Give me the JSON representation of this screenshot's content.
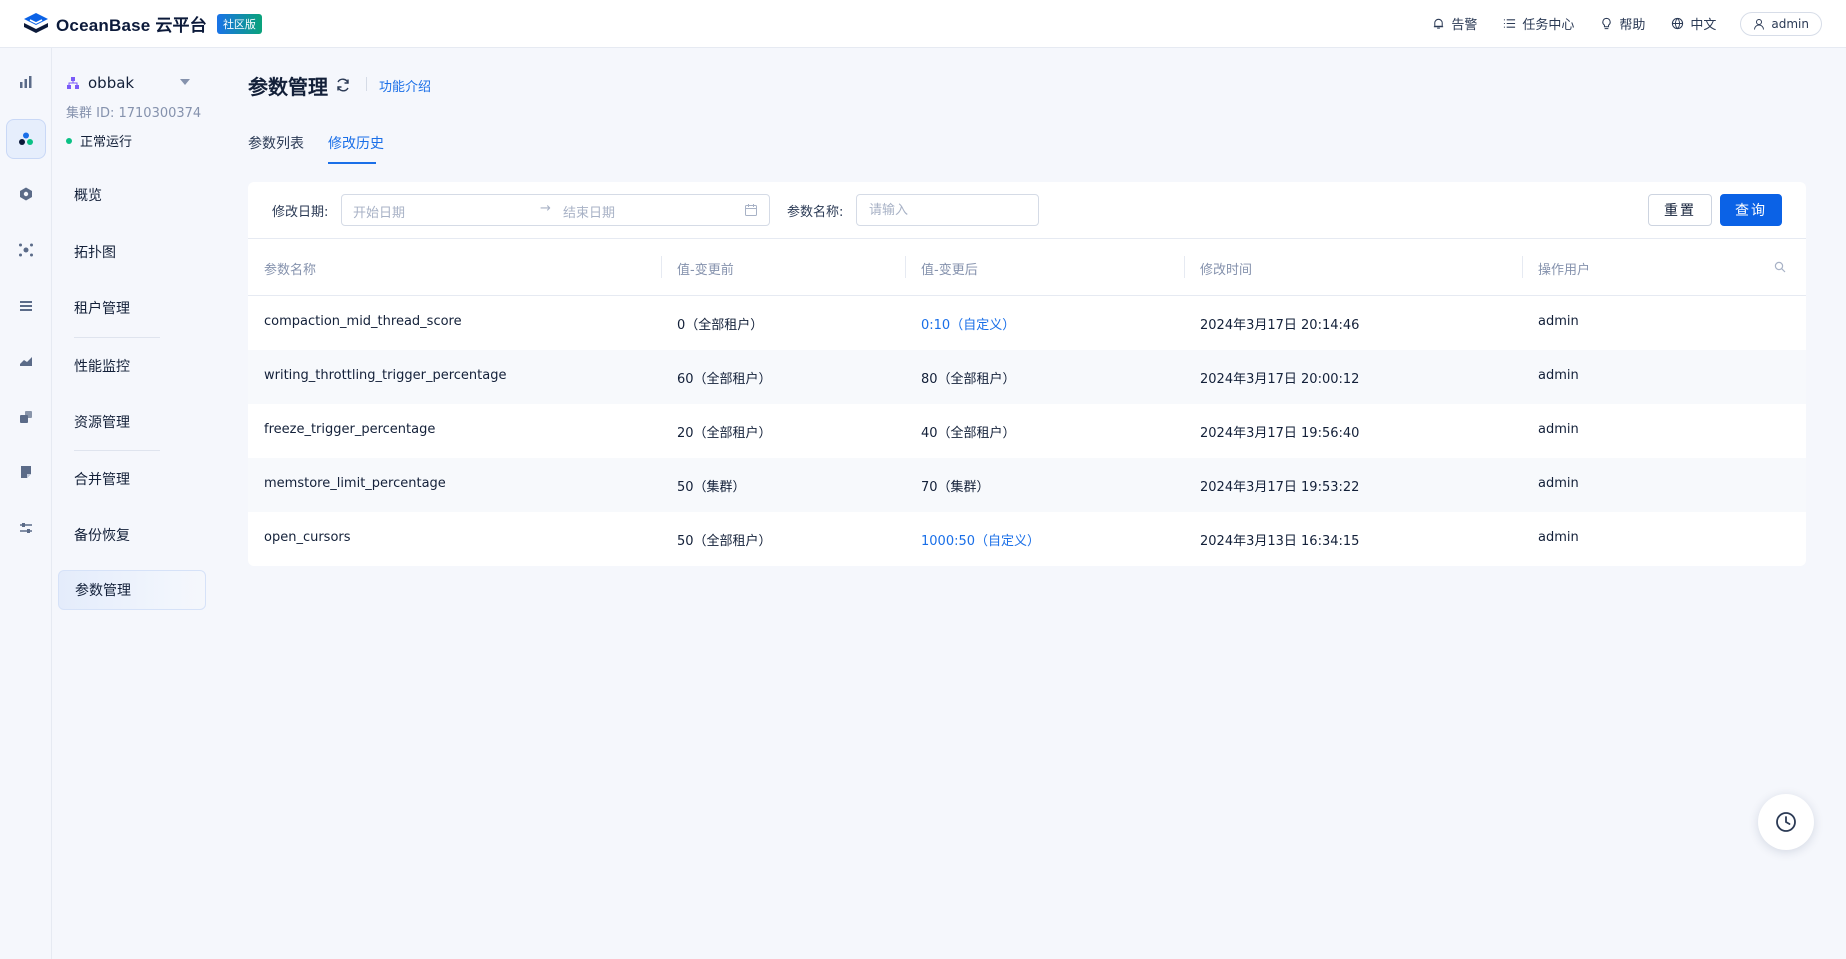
{
  "header": {
    "brand_name": "OceanBase 云平台",
    "brand_badge": "社区版",
    "alert_label": "告警",
    "task_center_label": "任务中心",
    "help_label": "帮助",
    "language_label": "中文",
    "user_label": "admin"
  },
  "cluster": {
    "name": "obbak",
    "id_text": "集群 ID: 1710300374",
    "status_text": "正常运行",
    "status_color": "#0ac185"
  },
  "subnav": {
    "items": [
      "概览",
      "拓扑图",
      "租户管理",
      "性能监控",
      "资源管理",
      "合并管理",
      "备份恢复",
      "参数管理"
    ],
    "active_index": 7
  },
  "page": {
    "title": "参数管理",
    "intro_link": "功能介绍",
    "tabs": [
      "参数列表",
      "修改历史"
    ],
    "active_tab": 1
  },
  "filters": {
    "date_label": "修改日期:",
    "start_placeholder": "开始日期",
    "arrow": "→",
    "end_placeholder": "结束日期",
    "name_label": "参数名称:",
    "name_placeholder": "请输入",
    "reset_label": "重置",
    "query_label": "查询"
  },
  "table": {
    "columns": [
      "参数名称",
      "值-变更前",
      "值-变更后",
      "修改时间",
      "操作用户"
    ],
    "rows": [
      {
        "name": "compaction_mid_thread_score",
        "before": "0（全部租户）",
        "after": "0:10（自定义）",
        "after_link": true,
        "time": "2024年3月17日 20:14:46",
        "user": "admin"
      },
      {
        "name": "writing_throttling_trigger_percentage",
        "before": "60（全部租户）",
        "after": "80（全部租户）",
        "after_link": false,
        "time": "2024年3月17日 20:00:12",
        "user": "admin"
      },
      {
        "name": "freeze_trigger_percentage",
        "before": "20（全部租户）",
        "after": "40（全部租户）",
        "after_link": false,
        "time": "2024年3月17日 19:56:40",
        "user": "admin"
      },
      {
        "name": "memstore_limit_percentage",
        "before": "50（集群）",
        "after": "70（集群）",
        "after_link": false,
        "time": "2024年3月17日 19:53:22",
        "user": "admin"
      },
      {
        "name": "open_cursors",
        "before": "50（全部租户）",
        "after": "1000:50（自定义）",
        "after_link": true,
        "time": "2024年3月13日 16:34:15",
        "user": "admin"
      }
    ]
  },
  "colors": {
    "accent": "#1a6fe8",
    "primary_button": "#0b62e6",
    "text": "#132039",
    "muted": "#8592ad"
  },
  "icons": {
    "rail": [
      "bar-chart-icon",
      "cluster-icon",
      "tenant-icon",
      "topology-icon",
      "list-icon",
      "monitor-icon",
      "resource-icon",
      "document-icon",
      "settings-sliders-icon"
    ],
    "float": "history-clock-icon"
  }
}
